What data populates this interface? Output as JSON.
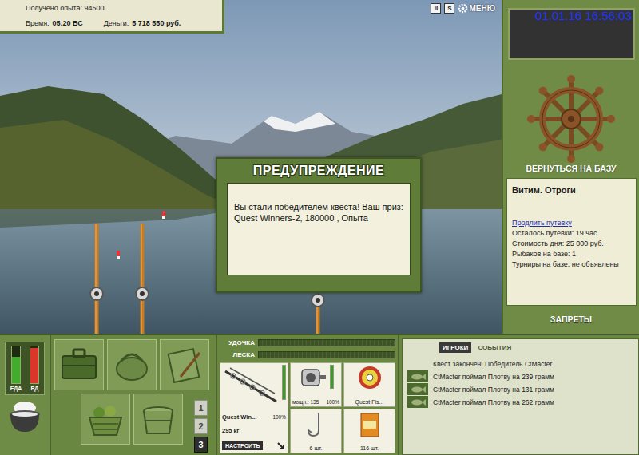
{
  "hud": {
    "experience": "Получено опыта: 94500",
    "time_label": "Время:",
    "time": "05:20 ВС",
    "money_label": "Деньги:",
    "money": "5 718 550 руб."
  },
  "top_buttons": [
    {
      "label": "II",
      "kind": "box"
    },
    {
      "label": "S",
      "kind": "box"
    },
    {
      "label": "МЕНЮ",
      "kind": "menu"
    }
  ],
  "clock": "01.01.16 16:56:03",
  "dialog": {
    "title": "ПРЕДУПРЕЖДЕНИЕ",
    "message": "Вы стали победителем квеста! Ваш приз: Quest Winners-2, 180000 , Опыта"
  },
  "side": {
    "return_button": "ВЕРНУТЬСЯ НА БАЗУ",
    "location": "Витим. Отроги",
    "extend_link": "Продлить путевку",
    "info": [
      "Осталось путевки: 19 час.",
      "Стоимость дня: 25 000 руб.",
      "Рыбаков на базе: 1",
      "Турниры на базе: не объявлены"
    ],
    "bans_button": "ЗАПРЕТЫ"
  },
  "meters": [
    {
      "label": "ЕДА",
      "level": 0.72,
      "color": "#3fae2a"
    },
    {
      "label": "ВД",
      "level": 0.96,
      "color": "#d8372a"
    }
  ],
  "slots": [
    {
      "label": "1",
      "selected": false
    },
    {
      "label": "2",
      "selected": false
    },
    {
      "label": "3",
      "selected": true
    }
  ],
  "tension": [
    {
      "label": "УДОЧКА",
      "level": 0
    },
    {
      "label": "ЛЕСКА",
      "level": 0
    }
  ],
  "tackle": {
    "rod": {
      "name": "Quest Win...",
      "weight": "295 кг",
      "condition": "100%",
      "level": 1,
      "button": "НАСТРОИТЬ"
    },
    "reel": {
      "power": "мощн.: 135",
      "condition": "100%",
      "level": 1
    },
    "line": {
      "name": "Quest Fis..."
    },
    "hook": {
      "count": "6 шт."
    },
    "bait": {
      "count": "116 шт."
    }
  },
  "chat": {
    "tabs": [
      {
        "label": "ИГРОКИ",
        "selected": true
      },
      {
        "label": "СОБЫТИЯ",
        "selected": false
      }
    ],
    "messages": [
      {
        "text": "Квест закончен! Победитель CtMacter",
        "kind": "notice"
      },
      {
        "text": "CtMacter поймал Плотву на 239 грамм",
        "kind": "catch"
      },
      {
        "text": "CtMacter поймал Плотву на 131 грамм",
        "kind": "catch"
      },
      {
        "text": "CtMacter поймал Плотву на 262 грамм",
        "kind": "catch"
      }
    ]
  }
}
